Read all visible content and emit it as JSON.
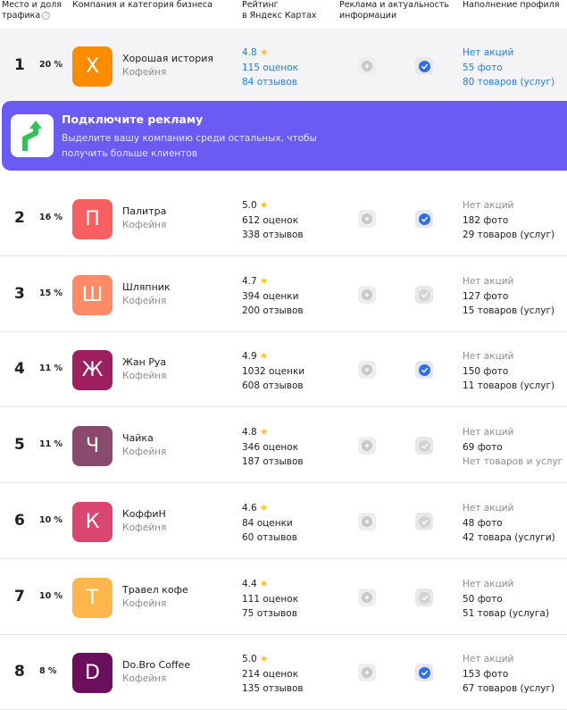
{
  "header": {
    "place_l1": "Место и доля",
    "place_l2": "трафика",
    "company": "Компания и категория бизнеса",
    "rating_l1": "Рейтинг",
    "rating_l2": "в Яндекс Картах",
    "ads_l1": "Реклама и актуальность",
    "ads_l2": "информации",
    "profile": "Наполнение профиля",
    "help_glyph": "?"
  },
  "colors": {
    "promo": "#6a5cf2",
    "link": "#1f7fd6",
    "star": "#fcc521",
    "check_active": "#2d6fe8"
  },
  "promo": {
    "title": "Подключите рекламу",
    "text": "Выделите вашу компанию среди остальных, чтобы получить больше клиентов"
  },
  "rows": [
    {
      "rank": "1",
      "share": "20 %",
      "letter": "Х",
      "color": "#fb8c00",
      "name": "Хорошая история",
      "category": "Кофейня",
      "rating": "4.8",
      "ratings_count": "115 оценок",
      "reviews": "84 отзывов",
      "ads": "none",
      "verified": true,
      "promos": "Нет акций",
      "photos": "55 фото",
      "goods": "80 товаров (услуг)"
    },
    {
      "rank": "2",
      "share": "16 %",
      "letter": "П",
      "color": "#f85f63",
      "name": "Палитра",
      "category": "Кофейня",
      "rating": "5.0",
      "ratings_count": "612 оценок",
      "reviews": "338 отзывов",
      "ads": "none",
      "verified": true,
      "promos": "Нет акций",
      "photos": "182 фото",
      "goods": "29 товаров (услуг)"
    },
    {
      "rank": "3",
      "share": "15 %",
      "letter": "Ш",
      "color": "#ff8a65",
      "name": "Шляпник",
      "category": "Кофейня",
      "rating": "4.7",
      "ratings_count": "394 оценки",
      "reviews": "200 отзывов",
      "ads": "none",
      "verified": false,
      "promos": "Нет акций",
      "photos": "127 фото",
      "goods": "15 товаров (услуг)"
    },
    {
      "rank": "4",
      "share": "11 %",
      "letter": "Ж",
      "color": "#9e1f5f",
      "name": "Жан Руа",
      "category": "Кофейня",
      "rating": "4.9",
      "ratings_count": "1032 оценки",
      "reviews": "608 отзывов",
      "ads": "none",
      "verified": true,
      "promos": "Нет акций",
      "photos": "150 фото",
      "goods": "11 товаров (услуг)"
    },
    {
      "rank": "5",
      "share": "11 %",
      "letter": "Ч",
      "color": "#8a4a6e",
      "name": "Чайка",
      "category": "Кофейня",
      "rating": "4.8",
      "ratings_count": "346 оценок",
      "reviews": "187 отзывов",
      "ads": "none",
      "verified": false,
      "promos": "Нет акций",
      "photos": "69 фото",
      "goods": "Нет товаров и услуг"
    },
    {
      "rank": "6",
      "share": "10 %",
      "letter": "К",
      "color": "#d94670",
      "name": "КоффиН",
      "category": "Кофейня",
      "rating": "4.6",
      "ratings_count": "84 оценки",
      "reviews": "60 отзывов",
      "ads": "none",
      "verified": false,
      "promos": "Нет акций",
      "photos": "48 фото",
      "goods": "42 товара (услуги)"
    },
    {
      "rank": "7",
      "share": "10 %",
      "letter": "Т",
      "color": "#ffb74d",
      "name": "Травел кофе",
      "category": "Кофейня",
      "rating": "4.4",
      "ratings_count": "111 оценок",
      "reviews": "75 отзывов",
      "ads": "none",
      "verified": false,
      "promos": "Нет акций",
      "photos": "50 фото",
      "goods": "51 товар (услуга)"
    },
    {
      "rank": "8",
      "share": "8 %",
      "letter": "D",
      "color": "#6b0f5d",
      "name": "Do.Bro Coffee",
      "category": "Кофейня",
      "rating": "5.0",
      "ratings_count": "214 оценок",
      "reviews": "135 отзывов",
      "ads": "none",
      "verified": true,
      "promos": "Нет акций",
      "photos": "153 фото",
      "goods": "67 товаров (услуг)"
    }
  ]
}
